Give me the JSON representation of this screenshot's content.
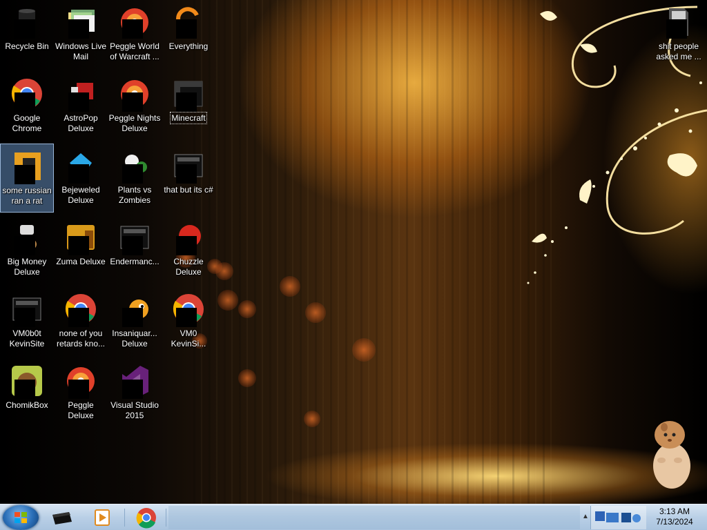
{
  "desktop": {
    "icons": [
      {
        "label": "Recycle Bin",
        "icon": "recycle-bin-icon"
      },
      {
        "label": "Windows Live Mail",
        "icon": "windows-live-mail-icon"
      },
      {
        "label": "Peggle World of Warcraft ...",
        "icon": "peggle-wow-icon"
      },
      {
        "label": "Everything",
        "icon": "everything-search-icon"
      },
      {
        "label": "Google Chrome",
        "icon": "chrome-icon"
      },
      {
        "label": "AstroPop Deluxe",
        "icon": "astropop-icon"
      },
      {
        "label": "Peggle Nights Deluxe",
        "icon": "peggle-nights-icon"
      },
      {
        "label": "Minecraft",
        "icon": "minecraft-icon"
      },
      {
        "label": "some russian ran a rat",
        "icon": "shortcut-icon"
      },
      {
        "label": "Bejeweled Deluxe",
        "icon": "bejeweled-icon"
      },
      {
        "label": "Plants vs Zombies",
        "icon": "plants-vs-zombies-icon"
      },
      {
        "label": "that but its c#",
        "icon": "application-icon"
      },
      {
        "label": "Big Money Deluxe",
        "icon": "big-money-icon"
      },
      {
        "label": "Zuma Deluxe",
        "icon": "zuma-icon"
      },
      {
        "label": "Endermanc...",
        "icon": "application-icon"
      },
      {
        "label": "Chuzzle Deluxe",
        "icon": "chuzzle-icon"
      },
      {
        "label": "VM0b0t KevinSite",
        "icon": "application-icon"
      },
      {
        "label": "none of you retards kno...",
        "icon": "chrome-icon"
      },
      {
        "label": "Insaniquar... Deluxe",
        "icon": "insaniquarium-icon"
      },
      {
        "label": "VM0 KevinSi...",
        "icon": "chrome-icon"
      },
      {
        "label": "ChomikBox",
        "icon": "chomikbox-icon"
      },
      {
        "label": "Peggle Deluxe",
        "icon": "peggle-icon"
      },
      {
        "label": "Visual Studio 2015",
        "icon": "visual-studio-icon"
      },
      {
        "label": "shit people asked me ...",
        "icon": "folder-icon"
      }
    ]
  },
  "taskbar": {
    "pinned": [
      {
        "name": "black-app-icon"
      },
      {
        "name": "media-player-icon"
      },
      {
        "name": "chrome-icon"
      }
    ],
    "clock": {
      "time": "3:13 AM",
      "date": "7/13/2024"
    }
  }
}
